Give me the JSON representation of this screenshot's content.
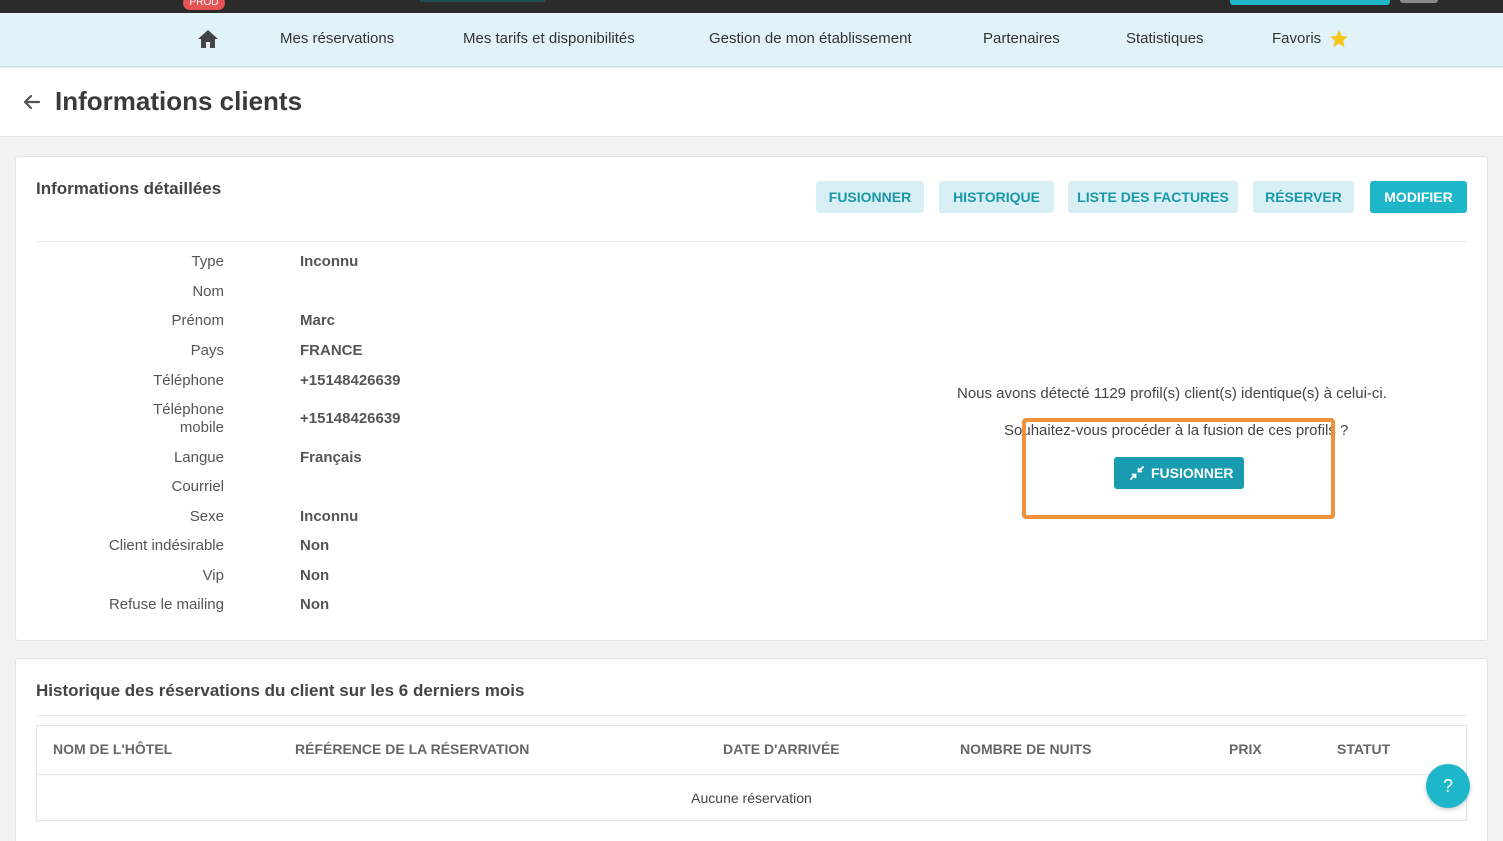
{
  "topbar": {
    "env_badge": "PROD"
  },
  "nav": {
    "items": [
      {
        "label": "Mes réservations"
      },
      {
        "label": "Mes tarifs et disponibilités"
      },
      {
        "label": "Gestion de mon établissement"
      },
      {
        "label": "Partenaires"
      },
      {
        "label": "Statistiques"
      },
      {
        "label": "Favoris"
      }
    ],
    "home_icon": "home-icon",
    "favorites_icon": "star-icon"
  },
  "header": {
    "title": "Informations clients",
    "back_icon": "arrow-left-icon"
  },
  "details": {
    "title": "Informations détaillées",
    "buttons": [
      "FUSIONNER",
      "HISTORIQUE",
      "LISTE DES FACTURES",
      "RÉSERVER",
      "MODIFIER"
    ],
    "fields": [
      {
        "label": "Type",
        "value": "Inconnu"
      },
      {
        "label": "Nom",
        "value": ""
      },
      {
        "label": "Prénom",
        "value": "Marc"
      },
      {
        "label": "Pays",
        "value": "FRANCE"
      },
      {
        "label": "Téléphone",
        "value": "+15148426639"
      },
      {
        "label": "Téléphone mobile",
        "value": "+15148426639"
      },
      {
        "label": "Langue",
        "value": "Français"
      },
      {
        "label": "Courriel",
        "value": ""
      },
      {
        "label": "Sexe",
        "value": "Inconnu"
      },
      {
        "label": "Client indésirable",
        "value": "Non"
      },
      {
        "label": "Vip",
        "value": "Non"
      },
      {
        "label": "Refuse le mailing",
        "value": "Non"
      }
    ],
    "merge": {
      "detected_text": "Nous avons détecté 1129 profil(s) client(s) identique(s) à celui-ci.",
      "question": "Souhaitez-vous procéder à la fusion de ces profils ?",
      "button_label": "FUSIONNER",
      "button_icon": "compress-arrows-icon"
    }
  },
  "history": {
    "title": "Historique des réservations du client sur les 6 derniers mois",
    "columns": [
      "NOM DE L'HÔTEL",
      "RÉFÉRENCE DE LA RÉSERVATION",
      "DATE D'ARRIVÉE",
      "NOMBRE DE NUITS",
      "PRIX",
      "STATUT"
    ],
    "empty_text": "Aucune réservation"
  },
  "help": {
    "label": "?"
  },
  "colors": {
    "accent": "#1eb6c9",
    "accent_dark": "#1a9cb0",
    "highlight": "#f0923b",
    "nav_bg": "#e1f3f8",
    "prod": "#e95252",
    "star": "#f5c518"
  }
}
